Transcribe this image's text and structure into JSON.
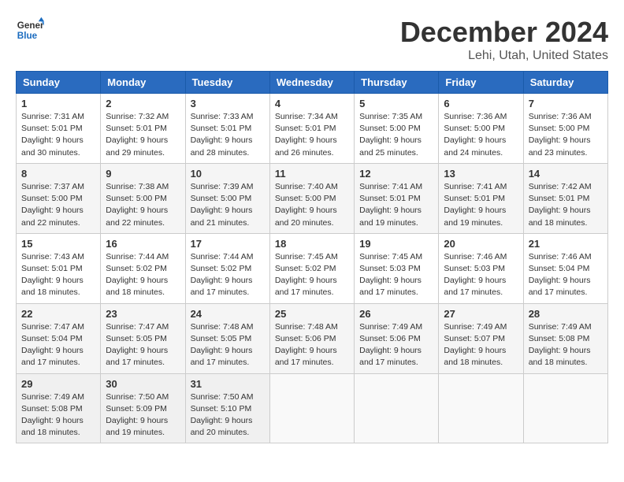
{
  "header": {
    "logo_line1": "General",
    "logo_line2": "Blue",
    "month": "December 2024",
    "location": "Lehi, Utah, United States"
  },
  "weekdays": [
    "Sunday",
    "Monday",
    "Tuesday",
    "Wednesday",
    "Thursday",
    "Friday",
    "Saturday"
  ],
  "weeks": [
    [
      {
        "day": "1",
        "info": "Sunrise: 7:31 AM\nSunset: 5:01 PM\nDaylight: 9 hours\nand 30 minutes."
      },
      {
        "day": "2",
        "info": "Sunrise: 7:32 AM\nSunset: 5:01 PM\nDaylight: 9 hours\nand 29 minutes."
      },
      {
        "day": "3",
        "info": "Sunrise: 7:33 AM\nSunset: 5:01 PM\nDaylight: 9 hours\nand 28 minutes."
      },
      {
        "day": "4",
        "info": "Sunrise: 7:34 AM\nSunset: 5:01 PM\nDaylight: 9 hours\nand 26 minutes."
      },
      {
        "day": "5",
        "info": "Sunrise: 7:35 AM\nSunset: 5:00 PM\nDaylight: 9 hours\nand 25 minutes."
      },
      {
        "day": "6",
        "info": "Sunrise: 7:36 AM\nSunset: 5:00 PM\nDaylight: 9 hours\nand 24 minutes."
      },
      {
        "day": "7",
        "info": "Sunrise: 7:36 AM\nSunset: 5:00 PM\nDaylight: 9 hours\nand 23 minutes."
      }
    ],
    [
      {
        "day": "8",
        "info": "Sunrise: 7:37 AM\nSunset: 5:00 PM\nDaylight: 9 hours\nand 22 minutes."
      },
      {
        "day": "9",
        "info": "Sunrise: 7:38 AM\nSunset: 5:00 PM\nDaylight: 9 hours\nand 22 minutes."
      },
      {
        "day": "10",
        "info": "Sunrise: 7:39 AM\nSunset: 5:00 PM\nDaylight: 9 hours\nand 21 minutes."
      },
      {
        "day": "11",
        "info": "Sunrise: 7:40 AM\nSunset: 5:00 PM\nDaylight: 9 hours\nand 20 minutes."
      },
      {
        "day": "12",
        "info": "Sunrise: 7:41 AM\nSunset: 5:01 PM\nDaylight: 9 hours\nand 19 minutes."
      },
      {
        "day": "13",
        "info": "Sunrise: 7:41 AM\nSunset: 5:01 PM\nDaylight: 9 hours\nand 19 minutes."
      },
      {
        "day": "14",
        "info": "Sunrise: 7:42 AM\nSunset: 5:01 PM\nDaylight: 9 hours\nand 18 minutes."
      }
    ],
    [
      {
        "day": "15",
        "info": "Sunrise: 7:43 AM\nSunset: 5:01 PM\nDaylight: 9 hours\nand 18 minutes."
      },
      {
        "day": "16",
        "info": "Sunrise: 7:44 AM\nSunset: 5:02 PM\nDaylight: 9 hours\nand 18 minutes."
      },
      {
        "day": "17",
        "info": "Sunrise: 7:44 AM\nSunset: 5:02 PM\nDaylight: 9 hours\nand 17 minutes."
      },
      {
        "day": "18",
        "info": "Sunrise: 7:45 AM\nSunset: 5:02 PM\nDaylight: 9 hours\nand 17 minutes."
      },
      {
        "day": "19",
        "info": "Sunrise: 7:45 AM\nSunset: 5:03 PM\nDaylight: 9 hours\nand 17 minutes."
      },
      {
        "day": "20",
        "info": "Sunrise: 7:46 AM\nSunset: 5:03 PM\nDaylight: 9 hours\nand 17 minutes."
      },
      {
        "day": "21",
        "info": "Sunrise: 7:46 AM\nSunset: 5:04 PM\nDaylight: 9 hours\nand 17 minutes."
      }
    ],
    [
      {
        "day": "22",
        "info": "Sunrise: 7:47 AM\nSunset: 5:04 PM\nDaylight: 9 hours\nand 17 minutes."
      },
      {
        "day": "23",
        "info": "Sunrise: 7:47 AM\nSunset: 5:05 PM\nDaylight: 9 hours\nand 17 minutes."
      },
      {
        "day": "24",
        "info": "Sunrise: 7:48 AM\nSunset: 5:05 PM\nDaylight: 9 hours\nand 17 minutes."
      },
      {
        "day": "25",
        "info": "Sunrise: 7:48 AM\nSunset: 5:06 PM\nDaylight: 9 hours\nand 17 minutes."
      },
      {
        "day": "26",
        "info": "Sunrise: 7:49 AM\nSunset: 5:06 PM\nDaylight: 9 hours\nand 17 minutes."
      },
      {
        "day": "27",
        "info": "Sunrise: 7:49 AM\nSunset: 5:07 PM\nDaylight: 9 hours\nand 18 minutes."
      },
      {
        "day": "28",
        "info": "Sunrise: 7:49 AM\nSunset: 5:08 PM\nDaylight: 9 hours\nand 18 minutes."
      }
    ],
    [
      {
        "day": "29",
        "info": "Sunrise: 7:49 AM\nSunset: 5:08 PM\nDaylight: 9 hours\nand 18 minutes."
      },
      {
        "day": "30",
        "info": "Sunrise: 7:50 AM\nSunset: 5:09 PM\nDaylight: 9 hours\nand 19 minutes."
      },
      {
        "day": "31",
        "info": "Sunrise: 7:50 AM\nSunset: 5:10 PM\nDaylight: 9 hours\nand 20 minutes."
      },
      {
        "day": "",
        "info": ""
      },
      {
        "day": "",
        "info": ""
      },
      {
        "day": "",
        "info": ""
      },
      {
        "day": "",
        "info": ""
      }
    ]
  ]
}
